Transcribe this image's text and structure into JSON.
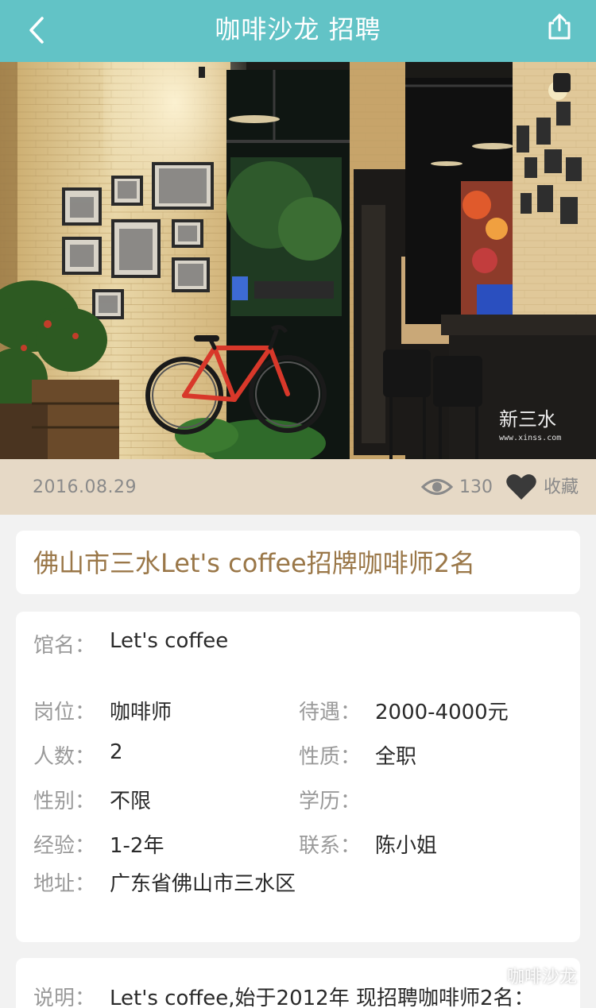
{
  "nav": {
    "title": "咖啡沙龙 招聘",
    "back_icon": "chevron-left-icon",
    "share_icon": "share-icon",
    "bar_color": "#62c3c6"
  },
  "hero": {
    "image_description_icon": "cafe-photo",
    "watermark_cn": "新三水",
    "watermark_url": "www.xinss.com"
  },
  "meta": {
    "date": "2016.08.29",
    "views": "130",
    "favorite_label": "收藏",
    "bar_color": "#e6d9c6"
  },
  "post": {
    "title": "佛山市三水Let's coffee招牌咖啡师2名"
  },
  "info": {
    "venue": {
      "label": "馆名：",
      "value": "Let's coffee"
    },
    "position": {
      "label": "岗位：",
      "value": "咖啡师"
    },
    "salary": {
      "label": "待遇：",
      "value": "2000-4000元"
    },
    "headcount": {
      "label": "人数：",
      "value": "2"
    },
    "type": {
      "label": "性质：",
      "value": "全职"
    },
    "gender": {
      "label": "性别：",
      "value": "不限"
    },
    "education": {
      "label": "学历：",
      "value": ""
    },
    "experience": {
      "label": "经验：",
      "value": "1-2年"
    },
    "contact": {
      "label": "联系：",
      "value": "陈小姐"
    },
    "address": {
      "label": "地址：",
      "value": "广东省佛山市三水区"
    }
  },
  "description": {
    "label": "说明：",
    "text": "Let's coffee,始于2012年  现招聘咖啡师2名："
  },
  "footer_watermark": {
    "text": "咖啡沙龙"
  },
  "colors": {
    "title_brown": "#9a7748",
    "label_gray": "#9a9a9a"
  }
}
